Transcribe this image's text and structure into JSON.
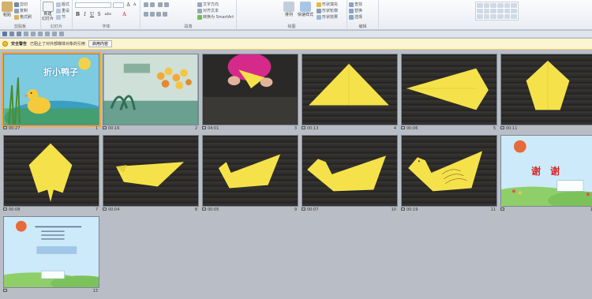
{
  "ribbon": {
    "clipboard": {
      "paste": "粘贴",
      "cut": "剪切",
      "copy": "复制",
      "format_painter": "格式刷",
      "group": "剪贴板"
    },
    "slides": {
      "new_slide": "新建\n幻灯片",
      "layout": "版式",
      "reset": "重设",
      "section": "节",
      "group": "幻灯片"
    },
    "font": {
      "group": "字体",
      "bold": "B",
      "italic": "I",
      "underline": "U",
      "strike": "S",
      "shadow": "abc"
    },
    "paragraph": {
      "group": "段落",
      "text_direction": "文字方向",
      "align_text": "对齐文本",
      "smartart": "转换为 SmartArt"
    },
    "drawing": {
      "group": "绘图",
      "arrange": "排列",
      "quick_styles": "快速样式",
      "fill": "形状填充",
      "outline": "形状轮廓",
      "effects": "形状效果"
    },
    "editing": {
      "group": "编辑",
      "find": "查找",
      "replace": "替换",
      "select": "选择"
    }
  },
  "security_bar": {
    "title": "安全警告",
    "message": "已阻止了对外部媒体对象的引用",
    "button": "启用内容"
  },
  "slides": [
    {
      "num": "1",
      "duration": "00:27",
      "title_text": "折小鸭子"
    },
    {
      "num": "2",
      "duration": "00:16"
    },
    {
      "num": "3",
      "duration": "04:01"
    },
    {
      "num": "4",
      "duration": "00:13"
    },
    {
      "num": "5",
      "duration": "00:06"
    },
    {
      "num": "6",
      "duration": "00:11"
    },
    {
      "num": "7",
      "duration": "00:08"
    },
    {
      "num": "8",
      "duration": "00:04"
    },
    {
      "num": "9",
      "duration": "00:05"
    },
    {
      "num": "10",
      "duration": "00:07"
    },
    {
      "num": "11",
      "duration": "00:19"
    },
    {
      "num": "12",
      "duration": "",
      "title_text": "谢 谢"
    },
    {
      "num": "13",
      "duration": ""
    }
  ],
  "colors": {
    "selection": "#f2a73b",
    "paper": "#f5e24a",
    "security_bg": "#fdf5cf"
  }
}
